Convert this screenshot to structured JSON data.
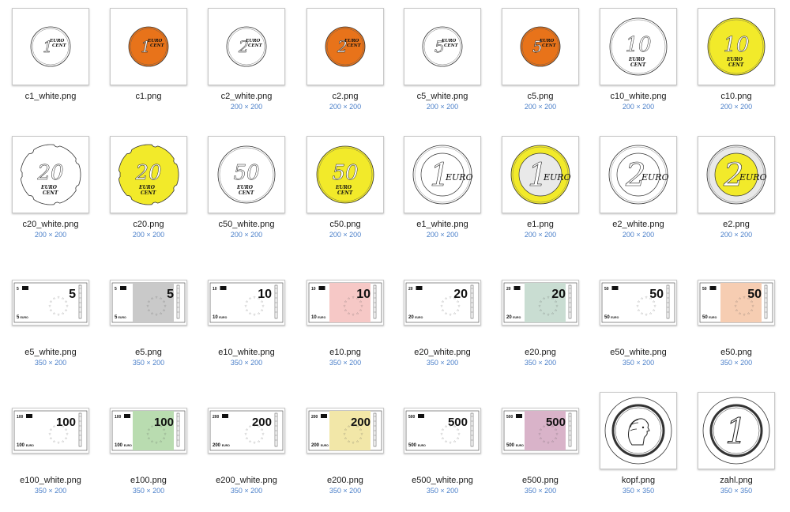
{
  "files": [
    {
      "name": "c1_white.png",
      "dims": "",
      "kind": "coin",
      "value": "1",
      "label": "EURO CENT",
      "fill": "#ffffff",
      "ring": null,
      "edge": "plain",
      "num_style": "small"
    },
    {
      "name": "c1.png",
      "dims": "",
      "kind": "coin",
      "value": "1",
      "label": "EURO CENT",
      "fill": "#e8731a",
      "ring": null,
      "edge": "plain",
      "num_style": "small"
    },
    {
      "name": "c2_white.png",
      "dims": "200 × 200",
      "kind": "coin",
      "value": "2",
      "label": "EURO CENT",
      "fill": "#ffffff",
      "ring": null,
      "edge": "plain",
      "num_style": "small"
    },
    {
      "name": "c2.png",
      "dims": "200 × 200",
      "kind": "coin",
      "value": "2",
      "label": "EURO CENT",
      "fill": "#e8731a",
      "ring": null,
      "edge": "plain",
      "num_style": "small"
    },
    {
      "name": "c5_white.png",
      "dims": "200 × 200",
      "kind": "coin",
      "value": "5",
      "label": "EURO CENT",
      "fill": "#ffffff",
      "ring": null,
      "edge": "plain",
      "num_style": "small"
    },
    {
      "name": "c5.png",
      "dims": "200 × 200",
      "kind": "coin",
      "value": "5",
      "label": "EURO CENT",
      "fill": "#e8731a",
      "ring": null,
      "edge": "plain",
      "num_style": "small"
    },
    {
      "name": "c10_white.png",
      "dims": "200 × 200",
      "kind": "coin",
      "value": "10",
      "label": "EURO CENT",
      "fill": "#ffffff",
      "ring": null,
      "edge": "plain",
      "num_style": "big"
    },
    {
      "name": "c10.png",
      "dims": "200 × 200",
      "kind": "coin",
      "value": "10",
      "label": "EURO CENT",
      "fill": "#f2ea2a",
      "ring": null,
      "edge": "plain",
      "num_style": "big"
    },
    {
      "name": "c20_white.png",
      "dims": "200 × 200",
      "kind": "coin",
      "value": "20",
      "label": "EURO CENT",
      "fill": "#ffffff",
      "ring": null,
      "edge": "notched",
      "num_style": "big"
    },
    {
      "name": "c20.png",
      "dims": "200 × 200",
      "kind": "coin",
      "value": "20",
      "label": "EURO CENT",
      "fill": "#f2ea2a",
      "ring": null,
      "edge": "notched",
      "num_style": "big"
    },
    {
      "name": "c50_white.png",
      "dims": "200 × 200",
      "kind": "coin",
      "value": "50",
      "label": "EURO CENT",
      "fill": "#ffffff",
      "ring": null,
      "edge": "plain",
      "num_style": "big"
    },
    {
      "name": "c50.png",
      "dims": "200 × 200",
      "kind": "coin",
      "value": "50",
      "label": "EURO CENT",
      "fill": "#f2ea2a",
      "ring": null,
      "edge": "plain",
      "num_style": "big"
    },
    {
      "name": "e1_white.png",
      "dims": "200 × 200",
      "kind": "euro",
      "value": "1",
      "label": "EURO",
      "fill": "#ffffff",
      "ring": "#ffffff"
    },
    {
      "name": "e1.png",
      "dims": "200 × 200",
      "kind": "euro",
      "value": "1",
      "label": "EURO",
      "fill": "#e9e9e9",
      "ring": "#f2ea2a"
    },
    {
      "name": "e2_white.png",
      "dims": "200 × 200",
      "kind": "euro",
      "value": "2",
      "label": "EURO",
      "fill": "#ffffff",
      "ring": "#ffffff"
    },
    {
      "name": "e2.png",
      "dims": "200 × 200",
      "kind": "euro",
      "value": "2",
      "label": "EURO",
      "fill": "#f2ea2a",
      "ring": "#e9e9e9"
    },
    {
      "name": "e5_white.png",
      "dims": "350 × 200",
      "kind": "note",
      "value": "5",
      "fill": "#ffffff"
    },
    {
      "name": "e5.png",
      "dims": "350 × 200",
      "kind": "note",
      "value": "5",
      "fill": "#c9c9c9"
    },
    {
      "name": "e10_white.png",
      "dims": "350 × 200",
      "kind": "note",
      "value": "10",
      "fill": "#ffffff"
    },
    {
      "name": "e10.png",
      "dims": "350 × 200",
      "kind": "note",
      "value": "10",
      "fill": "#f6c8c6"
    },
    {
      "name": "e20_white.png",
      "dims": "350 × 200",
      "kind": "note",
      "value": "20",
      "fill": "#ffffff"
    },
    {
      "name": "e20.png",
      "dims": "350 × 200",
      "kind": "note",
      "value": "20",
      "fill": "#c9ddd2"
    },
    {
      "name": "e50_white.png",
      "dims": "350 × 200",
      "kind": "note",
      "value": "50",
      "fill": "#ffffff"
    },
    {
      "name": "e50.png",
      "dims": "350 × 200",
      "kind": "note",
      "value": "50",
      "fill": "#f6cdb2"
    },
    {
      "name": "e100_white.png",
      "dims": "350 × 200",
      "kind": "note",
      "value": "100",
      "fill": "#ffffff"
    },
    {
      "name": "e100.png",
      "dims": "350 × 200",
      "kind": "note",
      "value": "100",
      "fill": "#b9dcb0"
    },
    {
      "name": "e200_white.png",
      "dims": "350 × 200",
      "kind": "note",
      "value": "200",
      "fill": "#ffffff"
    },
    {
      "name": "e200.png",
      "dims": "350 × 200",
      "kind": "note",
      "value": "200",
      "fill": "#f2e7a8"
    },
    {
      "name": "e500_white.png",
      "dims": "350 × 200",
      "kind": "note",
      "value": "500",
      "fill": "#ffffff"
    },
    {
      "name": "e500.png",
      "dims": "350 × 200",
      "kind": "note",
      "value": "500",
      "fill": "#d9b3c9"
    },
    {
      "name": "kopf.png",
      "dims": "350 × 350",
      "kind": "kopf"
    },
    {
      "name": "zahl.png",
      "dims": "350 × 350",
      "kind": "zahl",
      "value": "1"
    }
  ]
}
